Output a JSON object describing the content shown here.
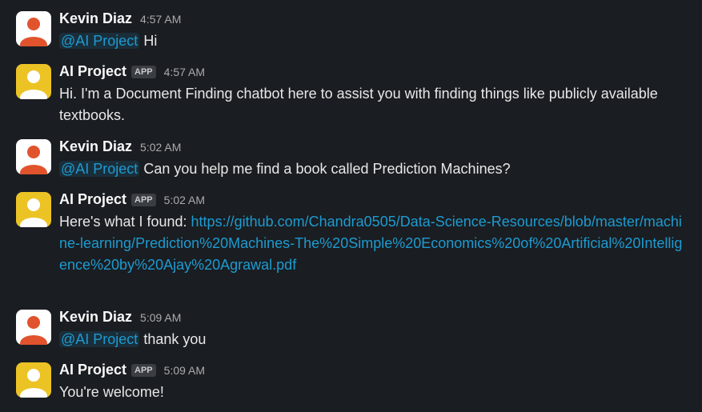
{
  "messages": [
    {
      "author": "Kevin Diaz",
      "time": "4:57 AM",
      "mention": "@AI Project",
      "text": "Hi"
    },
    {
      "author": "AI Project",
      "badge": "APP",
      "time": "4:57 AM",
      "text": "Hi. I'm a Document Finding chatbot here to assist you with finding things like publicly available textbooks."
    },
    {
      "author": "Kevin Diaz",
      "time": "5:02 AM",
      "mention": "@AI Project",
      "text": "Can you help me find a book called Prediction Machines?"
    },
    {
      "author": "AI Project",
      "badge": "APP",
      "time": "5:02 AM",
      "text": "Here's what I found:",
      "link": "https://github.com/Chandra0505/Data-Science-Resources/blob/master/machine-learning/Prediction%20Machines-The%20Simple%20Economics%20of%20Artificial%20Intelligence%20by%20Ajay%20Agrawal.pdf"
    },
    {
      "author": "Kevin Diaz",
      "time": "5:09 AM",
      "mention": "@AI Project",
      "text": "thank you"
    },
    {
      "author": "AI Project",
      "badge": "APP",
      "time": "5:09 AM",
      "text": "You're welcome!"
    }
  ],
  "colors": {
    "background": "#1a1d21",
    "user_avatar_bg": "#ffffff",
    "user_avatar_figure": "#e0532d",
    "bot_avatar_bg": "#ecc324",
    "bot_avatar_figure": "#ffffff",
    "link": "#1d9bd1"
  },
  "icons": {
    "user_avatar": "person-avatar-icon",
    "bot_avatar": "person-avatar-icon"
  }
}
